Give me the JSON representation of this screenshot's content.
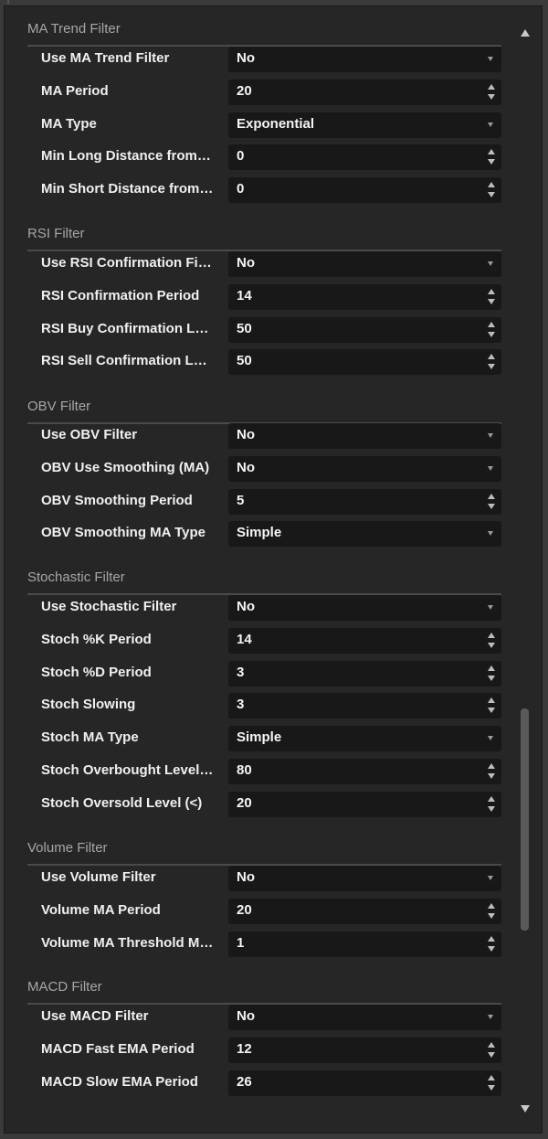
{
  "sections": [
    {
      "title": "MA Trend Filter",
      "rows": [
        {
          "label": "Use MA Trend Filter",
          "value": "No",
          "control": "dropdown"
        },
        {
          "label": "MA Period",
          "value": "20",
          "control": "spinner"
        },
        {
          "label": "MA Type",
          "value": "Exponential",
          "control": "dropdown"
        },
        {
          "label": "Min Long Distance from…",
          "value": "0",
          "control": "spinner"
        },
        {
          "label": "Min Short Distance from…",
          "value": "0",
          "control": "spinner"
        }
      ]
    },
    {
      "title": "RSI Filter",
      "rows": [
        {
          "label": "Use RSI Confirmation Fil…",
          "value": "No",
          "control": "dropdown"
        },
        {
          "label": "RSI Confirmation Period",
          "value": "14",
          "control": "spinner"
        },
        {
          "label": "RSI Buy Confirmation Le…",
          "value": "50",
          "control": "spinner"
        },
        {
          "label": "RSI Sell Confirmation Le…",
          "value": "50",
          "control": "spinner"
        }
      ]
    },
    {
      "title": "OBV Filter",
      "rows": [
        {
          "label": "Use OBV Filter",
          "value": "No",
          "control": "dropdown"
        },
        {
          "label": "OBV Use Smoothing (MA)",
          "value": "No",
          "control": "dropdown"
        },
        {
          "label": "OBV Smoothing Period",
          "value": "5",
          "control": "spinner"
        },
        {
          "label": "OBV Smoothing MA Type",
          "value": "Simple",
          "control": "dropdown"
        }
      ]
    },
    {
      "title": "Stochastic Filter",
      "rows": [
        {
          "label": "Use Stochastic Filter",
          "value": "No",
          "control": "dropdown"
        },
        {
          "label": "Stoch %K Period",
          "value": "14",
          "control": "spinner"
        },
        {
          "label": "Stoch %D Period",
          "value": "3",
          "control": "spinner"
        },
        {
          "label": "Stoch Slowing",
          "value": "3",
          "control": "spinner"
        },
        {
          "label": "Stoch MA Type",
          "value": "Simple",
          "control": "dropdown"
        },
        {
          "label": "Stoch Overbought Level…",
          "value": "80",
          "control": "spinner"
        },
        {
          "label": "Stoch Oversold Level (<)",
          "value": "20",
          "control": "spinner"
        }
      ]
    },
    {
      "title": "Volume Filter",
      "rows": [
        {
          "label": "Use Volume Filter",
          "value": "No",
          "control": "dropdown"
        },
        {
          "label": "Volume MA Period",
          "value": "20",
          "control": "spinner"
        },
        {
          "label": "Volume MA Threshold M…",
          "value": "1",
          "control": "spinner"
        }
      ]
    },
    {
      "title": "MACD Filter",
      "rows": [
        {
          "label": "Use MACD Filter",
          "value": "No",
          "control": "dropdown"
        },
        {
          "label": "MACD Fast EMA Period",
          "value": "12",
          "control": "spinner"
        },
        {
          "label": "MACD Slow EMA Period",
          "value": "26",
          "control": "spinner"
        }
      ]
    }
  ],
  "icons": {
    "dropdown": "chevron-down-icon",
    "spinner": "spinner-arrows-icon",
    "scroll_up": "scroll-up-arrow-icon",
    "scroll_down": "scroll-down-arrow-icon"
  },
  "colors": {
    "panel_background": "#262626",
    "field_background": "#181818",
    "section_title": "#a6a6a6",
    "text": "#f0f0f0"
  }
}
